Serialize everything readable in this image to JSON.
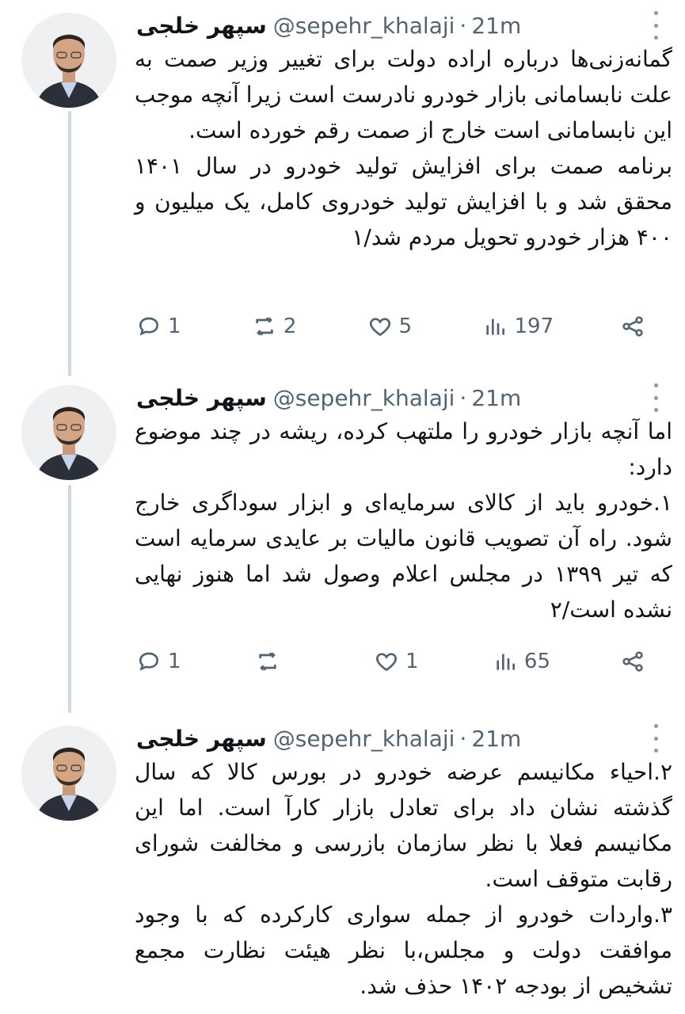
{
  "tweets": [
    {
      "display_name": "سپهر خلجی",
      "handle": "@sepehr_khalaji",
      "separator": "·",
      "time": "21m",
      "paragraphs": [
        "گمانه‌زنی‌ها درباره اراده دولت برای تغییر وزیر صمت به علت نابسامانی بازار خودرو نادرست است زیرا آنچه موجب این نابسامانی است خارج از صمت رقم خورده است.",
        "برنامه صمت برای افزایش تولید خودرو در سال ۱۴۰۱ محقق شد و با افزایش تولید خودروی کامل، یک میلیون و ۴۰۰ هزار خودرو تحویل مردم شد/۱"
      ],
      "replies": "1",
      "retweets": "2",
      "likes": "5",
      "views": "197"
    },
    {
      "display_name": "سپهر خلجی",
      "handle": "@sepehr_khalaji",
      "separator": "·",
      "time": "21m",
      "paragraphs": [
        "اما آنچه بازار خودرو را ملتهب کرده، ریشه در چند موضوع دارد:",
        "۱.خودرو باید از کالای سرمایه‌ای و ابزار سوداگری خارج شود. راه آن تصویب قانون مالیات بر عایدی سرمایه است که تیر ۱۳۹۹ در مجلس اعلام وصول شد اما هنوز نهایی نشده است/۲"
      ],
      "replies": "1",
      "retweets": "",
      "likes": "1",
      "views": "65"
    },
    {
      "display_name": "سپهر خلجی",
      "handle": "@sepehr_khalaji",
      "separator": "·",
      "time": "21m",
      "paragraphs": [
        "۲.احیاء مکانیسم عرضه خودرو در بورس کالا که سال گذشته نشان داد برای تعادل بازار کارآ است. اما این مکانیسم فعلا با نظر سازمان بازرسی و مخالفت شورای رقابت متوقف است.",
        "۳.واردات خودرو از جمله سواری کارکرده که با وجود موافقت دولت و مجلس،با نظر هیئت نظارت مجمع تشخیص از بودجه ۱۴۰۲ حذف شد."
      ]
    }
  ],
  "colors": {
    "text": "#0f1419",
    "secondary": "#536471",
    "thread_line": "#cfd9de"
  },
  "icons": [
    "more-icon",
    "reply-icon",
    "retweet-icon",
    "like-icon",
    "views-icon",
    "share-icon"
  ]
}
